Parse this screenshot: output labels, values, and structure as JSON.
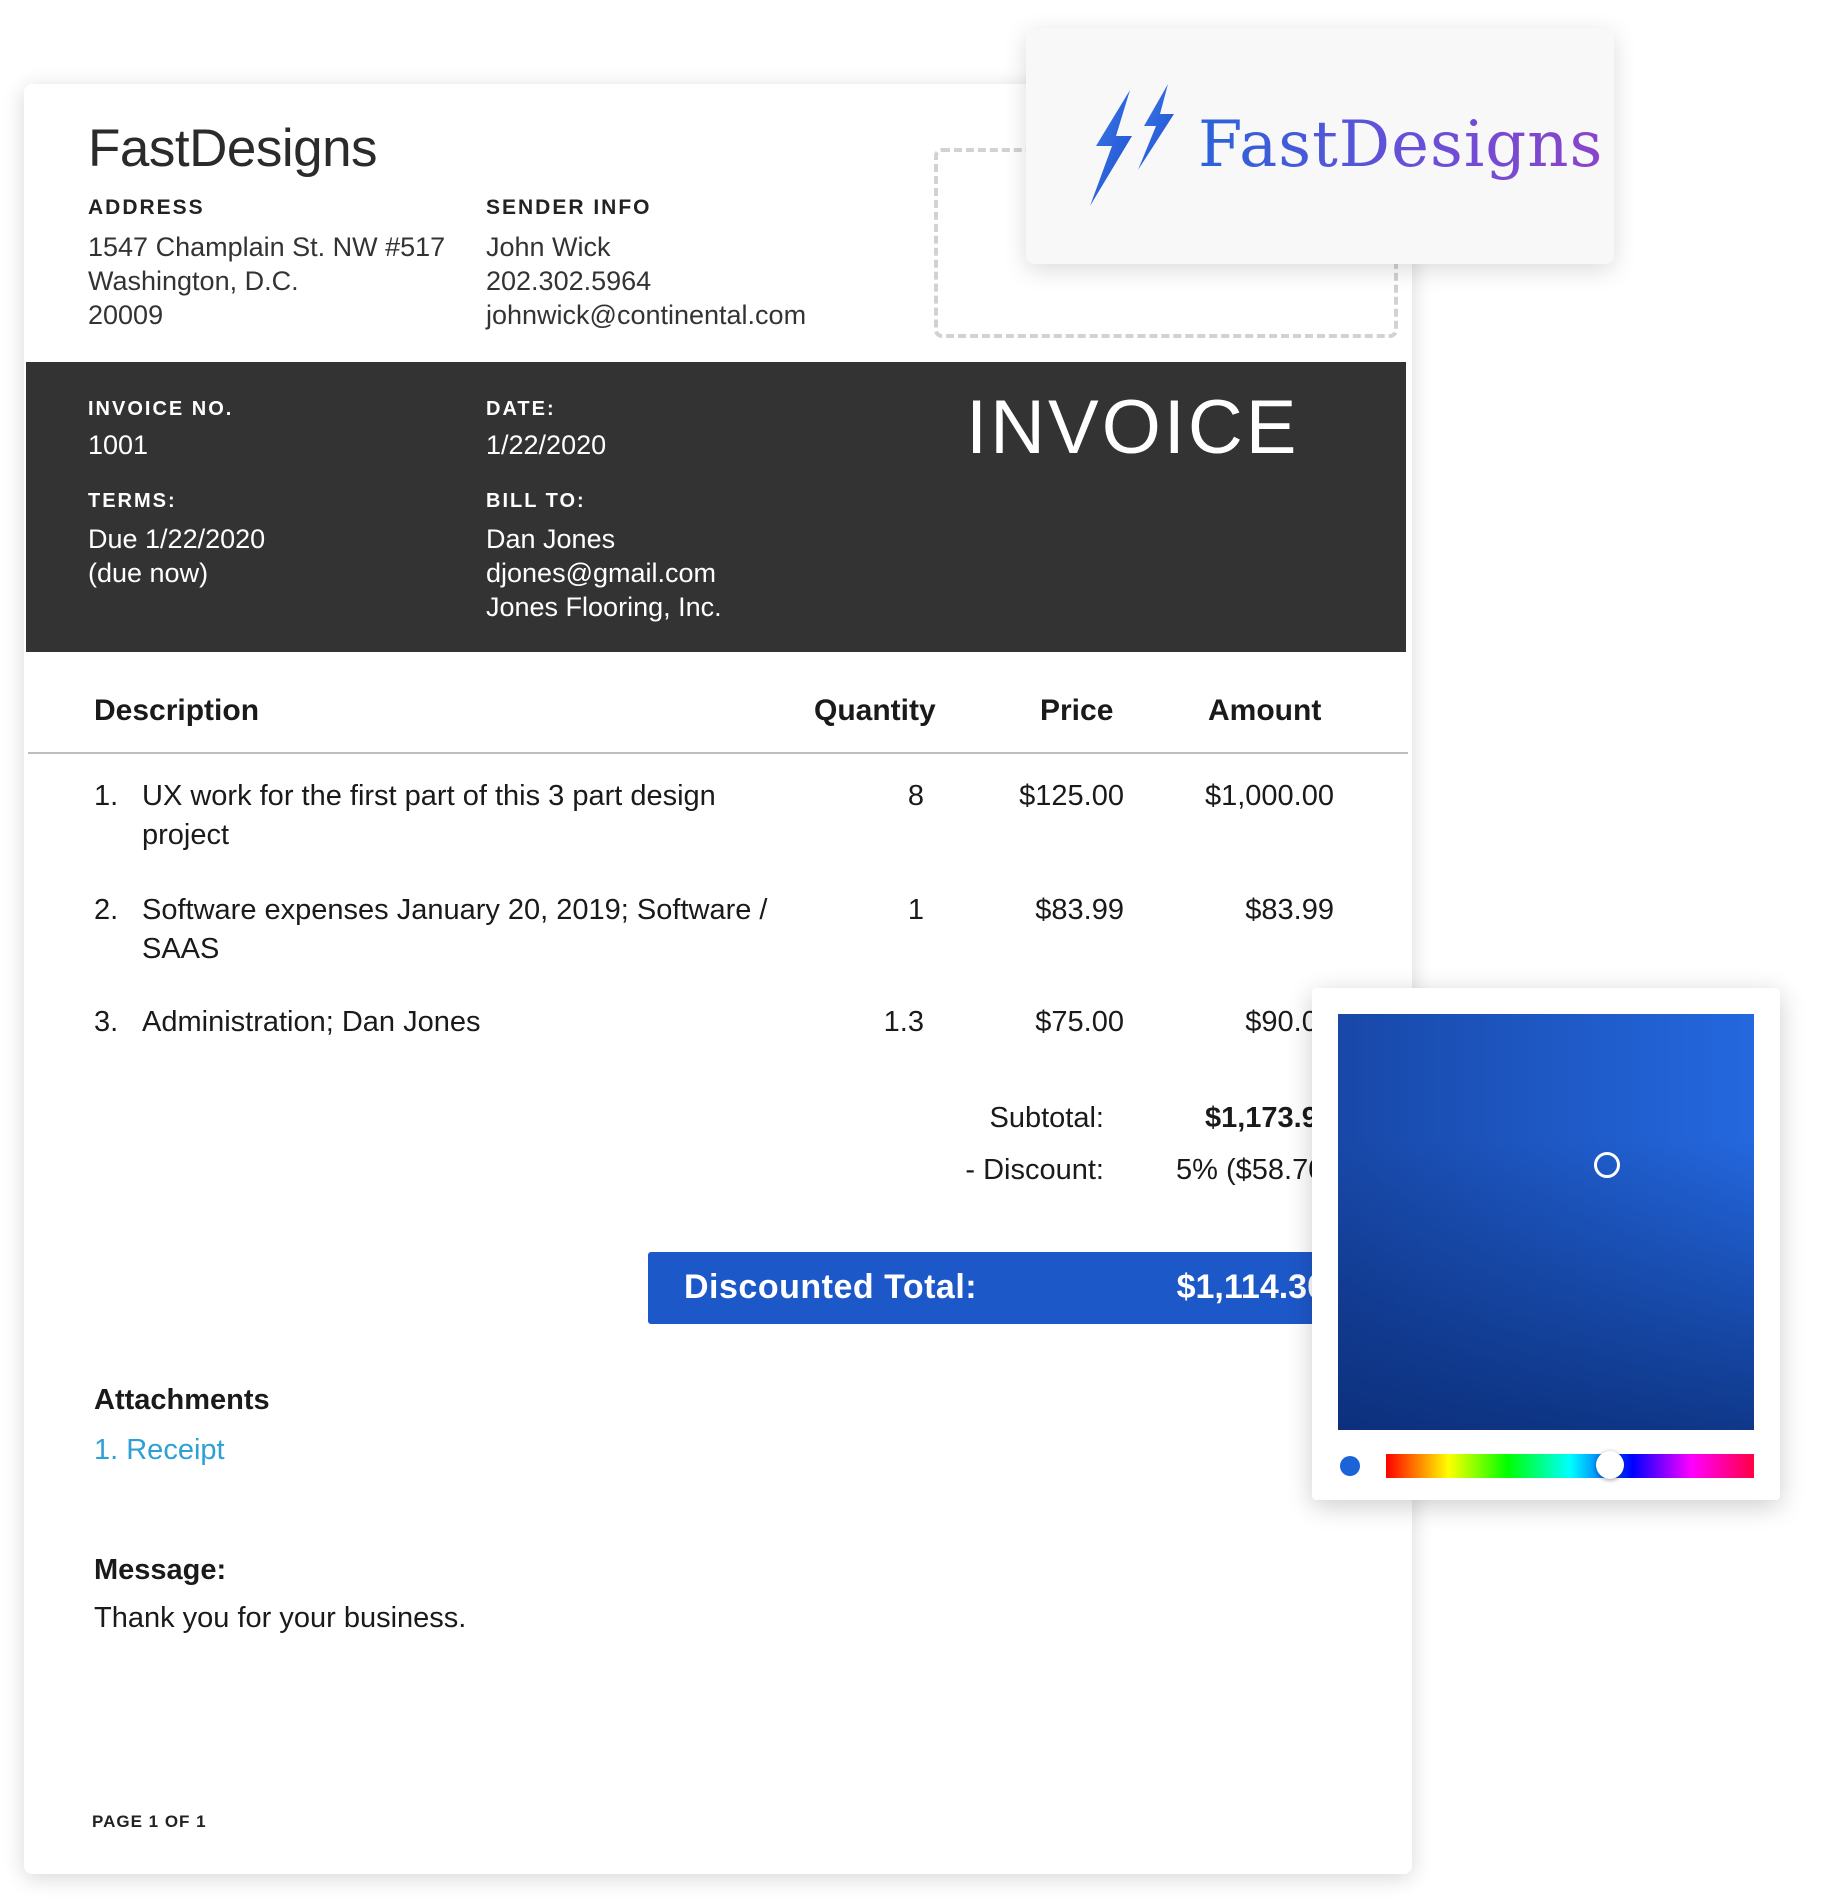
{
  "brand": {
    "name": "FastDesigns"
  },
  "sender": {
    "address_label": "ADDRESS",
    "address": "1547 Champlain St. NW #517\nWashington, D.C.\n20009",
    "info_label": "SENDER INFO",
    "info": "John Wick\n202.302.5964\njohnwick@continental.com"
  },
  "header": {
    "title": "INVOICE",
    "invoice_no_label": "INVOICE NO.",
    "invoice_no": "1001",
    "date_label": "DATE:",
    "date": "1/22/2020",
    "terms_label": "TERMS:",
    "terms": "Due 1/22/2020\n(due now)",
    "bill_to_label": "BILL TO:",
    "bill_to": "Dan Jones\ndjones@gmail.com\nJones Flooring, Inc."
  },
  "table": {
    "columns": [
      "Description",
      "Quantity",
      "Price",
      "Amount"
    ],
    "rows": [
      {
        "num": "1.",
        "description": "UX work for the first part of this 3 part design project",
        "quantity": "8",
        "price": "$125.00",
        "amount": "$1,000.00"
      },
      {
        "num": "2.",
        "description": "Software expenses January 20, 2019; Software / SAAS",
        "quantity": "1",
        "price": "$83.99",
        "amount": "$83.99"
      },
      {
        "num": "3.",
        "description": "Administration; Dan Jones",
        "quantity": "1.3",
        "price": "$75.00",
        "amount": "$90.00"
      }
    ]
  },
  "summary": {
    "subtotal_label": "Subtotal:",
    "subtotal": "$1,173.99",
    "discount_label": "- Discount:",
    "discount": "5% ($58.70)",
    "total_label": "Discounted Total:",
    "total": "$1,114.30"
  },
  "attachments": {
    "title": "Attachments",
    "items": [
      "1. Receipt"
    ]
  },
  "message": {
    "title": "Message:",
    "body": "Thank you for your business."
  },
  "footer": {
    "page": "PAGE 1 OF 1"
  },
  "logo_card": {
    "text": "FastDesigns",
    "icon": "lightning-bolt-icon"
  },
  "color_picker": {
    "selected_color": "#1d63d8",
    "hue_position": 0.62,
    "icons": [
      "color-swatch",
      "hue-slider"
    ]
  },
  "colors": {
    "accent": "#1d58c9",
    "dark_band": "#333333",
    "link": "#2ea0d6"
  }
}
